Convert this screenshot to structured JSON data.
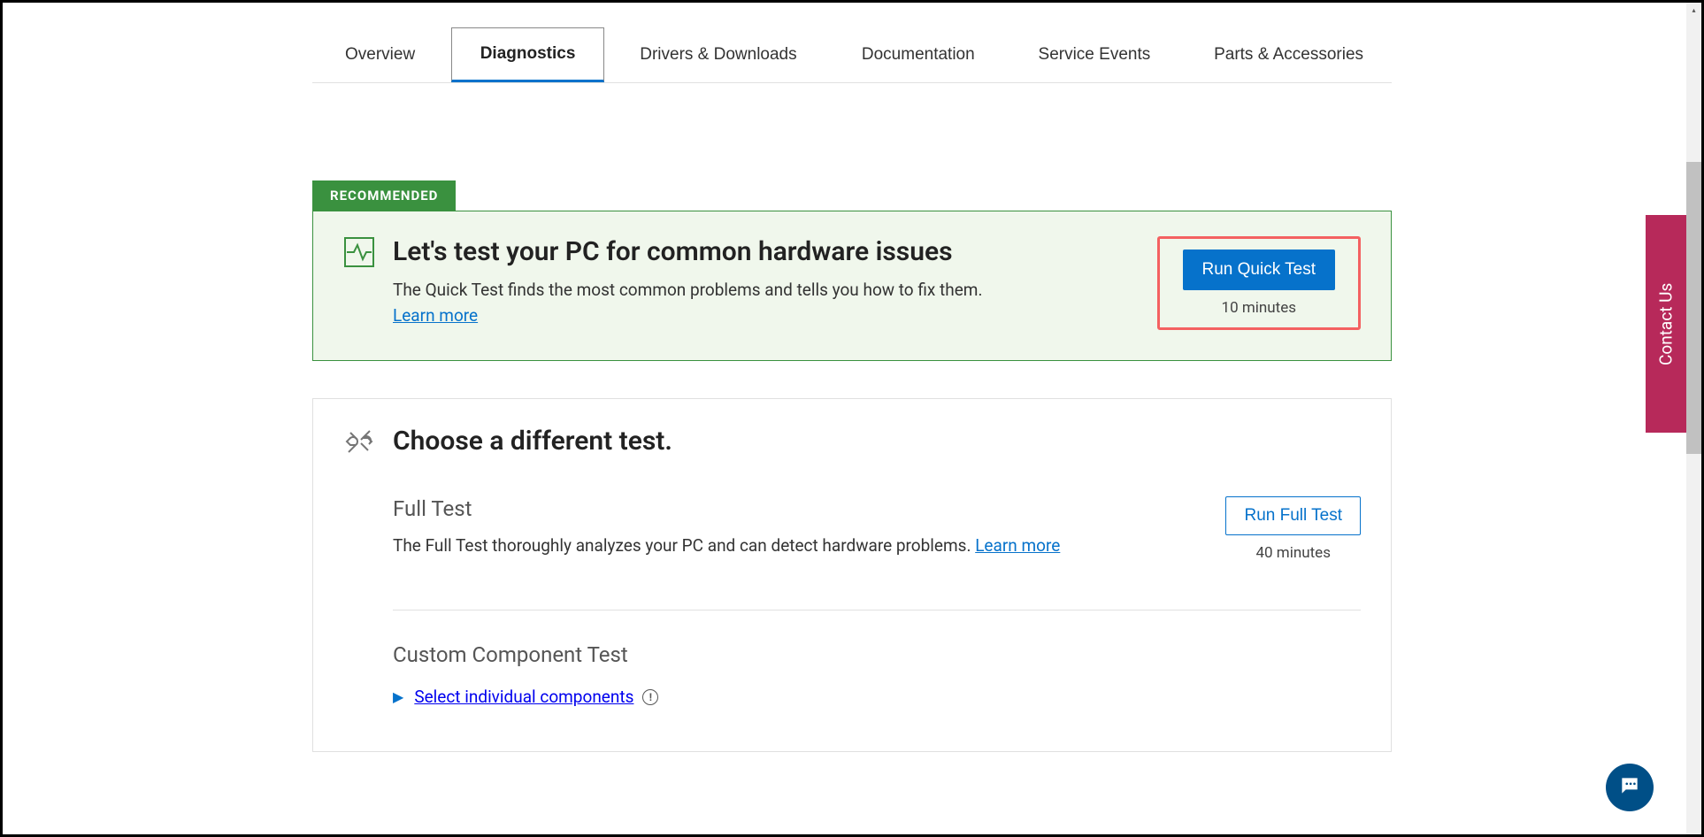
{
  "tabs": {
    "overview": "Overview",
    "diagnostics": "Diagnostics",
    "drivers": "Drivers & Downloads",
    "documentation": "Documentation",
    "service_events": "Service Events",
    "parts": "Parts & Accessories"
  },
  "recommended": {
    "badge": "RECOMMENDED",
    "title": "Let's test your PC for common hardware issues",
    "description": "The Quick Test finds the most common problems and tells you how to fix them.",
    "learn_more": "Learn more",
    "button": "Run Quick Test",
    "duration": "10 minutes"
  },
  "alternate": {
    "title": "Choose a different test.",
    "full_test": {
      "name": "Full Test",
      "description": "The Full Test thoroughly analyzes your PC and can detect hardware problems. ",
      "learn_more": "Learn more",
      "button": "Run Full Test",
      "duration": "40 minutes"
    },
    "custom": {
      "name": "Custom Component Test",
      "link": "Select individual components"
    }
  },
  "contact_us": "Contact Us"
}
